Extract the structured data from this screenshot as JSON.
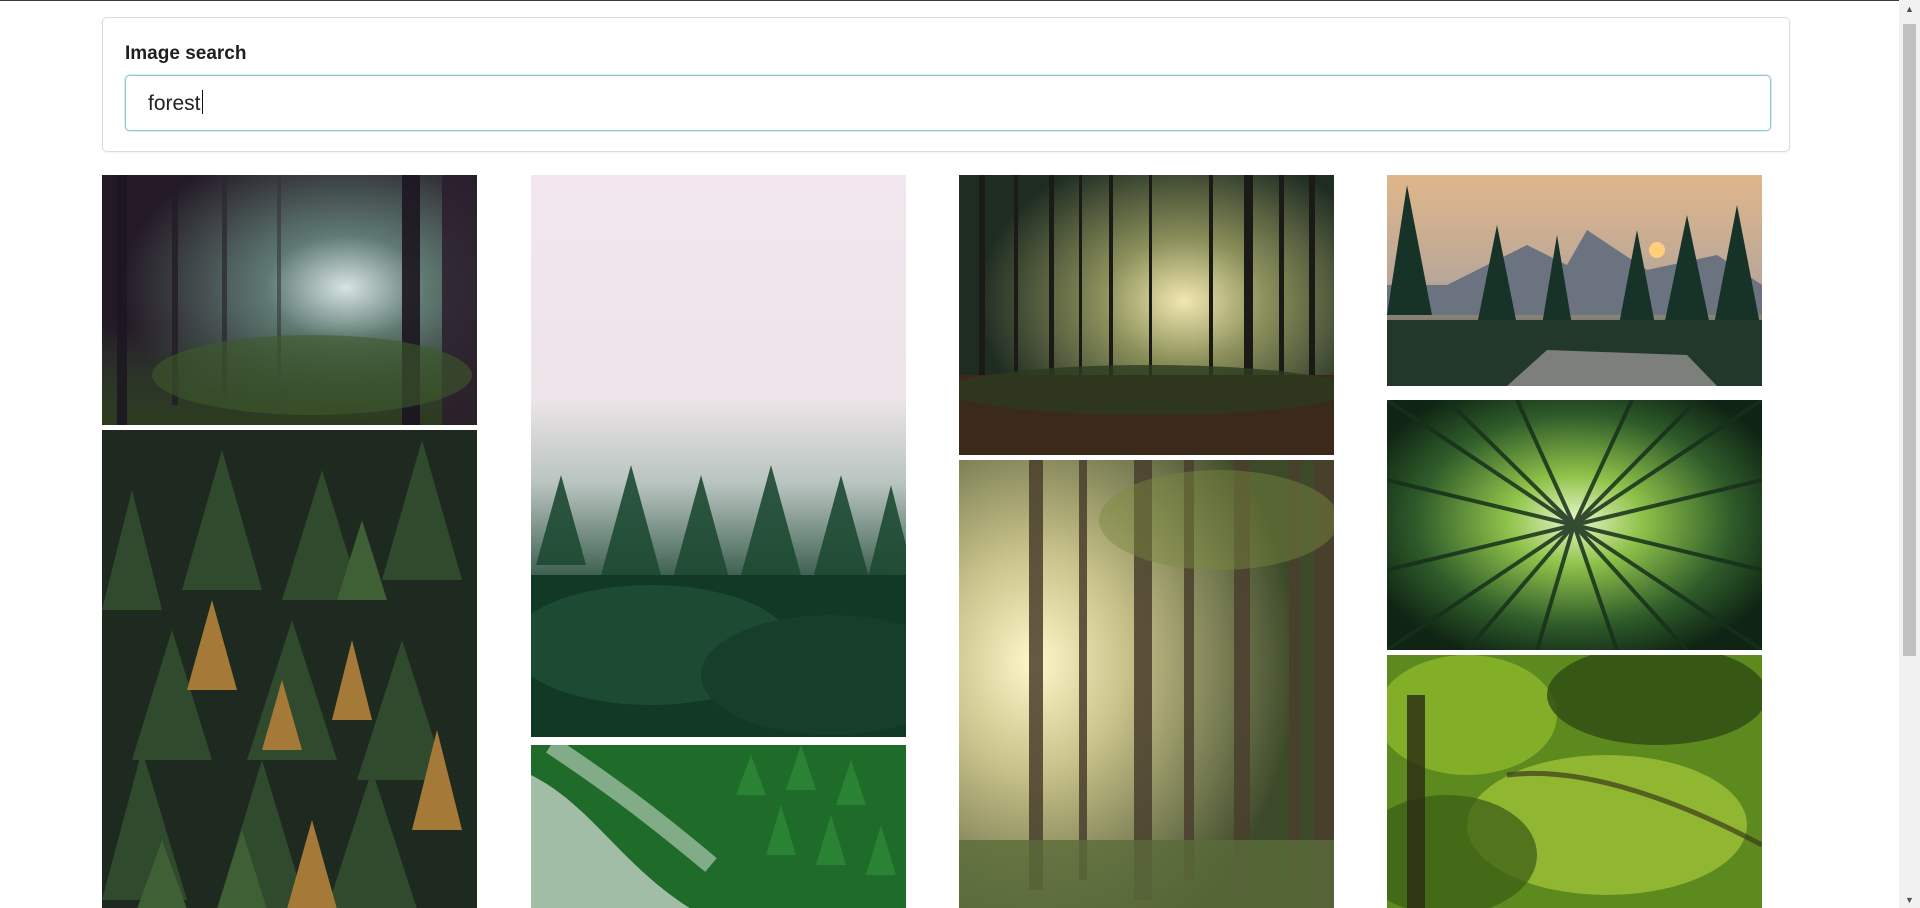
{
  "search": {
    "label": "Image search",
    "value": "forest"
  },
  "results": [
    {
      "name": "misty-dark-forest",
      "column": 1,
      "alt": ""
    },
    {
      "name": "autumn-conifer-canopy",
      "column": 1,
      "alt": ""
    },
    {
      "name": "foggy-treeline-pink-sky",
      "column": 2,
      "alt": ""
    },
    {
      "name": "green-pine-hillside-mist",
      "column": 2,
      "alt": ""
    },
    {
      "name": "pine-trunks-sunlight",
      "column": 3,
      "alt": ""
    },
    {
      "name": "sunbeams-through-forest",
      "column": 3,
      "alt": ""
    },
    {
      "name": "mountain-sunset-pines",
      "column": 4,
      "alt": ""
    },
    {
      "name": "bamboo-canopy-from-below",
      "column": 4,
      "alt": ""
    },
    {
      "name": "lush-green-leaves",
      "column": 4,
      "alt": ""
    }
  ],
  "colors": {
    "input_focus_border": "#8ec3d6",
    "card_border": "#dcdcdc",
    "scrollbar_thumb": "#c1c1c1"
  }
}
